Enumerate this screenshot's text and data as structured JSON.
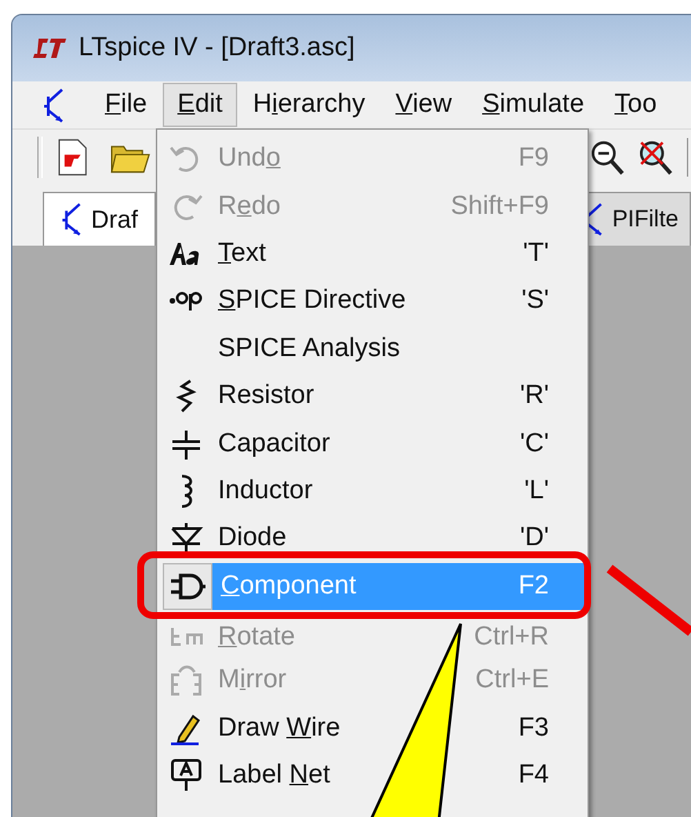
{
  "window": {
    "title": "LTspice IV - [Draft3.asc]"
  },
  "menu_bar": [
    {
      "key": "F",
      "post": "ile",
      "selected": false
    },
    {
      "key": "E",
      "post": "dit",
      "selected": true
    },
    {
      "pre": "H",
      "key": "i",
      "post": "erarchy",
      "selected": false
    },
    {
      "key": "V",
      "post": "iew",
      "selected": false
    },
    {
      "key": "S",
      "post": "imulate",
      "selected": false
    },
    {
      "key": "T",
      "post": "oo",
      "selected": false
    }
  ],
  "tabs": [
    {
      "label": "Draf",
      "selected": true
    },
    {
      "label": "PIFilte",
      "selected": false
    }
  ],
  "edit_menu": [
    {
      "label": {
        "pre": "Und",
        "key": "o"
      },
      "shortcut": "F9",
      "disabled": true,
      "selected": false
    },
    {
      "label": {
        "pre": "R",
        "key": "e",
        "post": "do"
      },
      "shortcut": "Shift+F9",
      "disabled": true,
      "selected": false
    },
    {
      "label": {
        "key": "T",
        "post": "ext"
      },
      "shortcut": "'T'",
      "disabled": false,
      "selected": false
    },
    {
      "label": {
        "key": "S",
        "post": "PICE Directive"
      },
      "shortcut": "'S'",
      "disabled": false,
      "selected": false
    },
    {
      "label": {
        "pre": "SPICE Analysis"
      },
      "disabled": false,
      "selected": false
    },
    {
      "label": {
        "pre": "Resistor"
      },
      "shortcut": "'R'",
      "disabled": false,
      "selected": false
    },
    {
      "label": {
        "pre": "Capacitor"
      },
      "shortcut": "'C'",
      "disabled": false,
      "selected": false
    },
    {
      "label": {
        "pre": "Inductor"
      },
      "shortcut": "'L'",
      "disabled": false,
      "selected": false
    },
    {
      "label": {
        "pre": "Diode"
      },
      "shortcut": "'D'",
      "disabled": false,
      "selected": false
    },
    {
      "label": {
        "key": "C",
        "post": "omponent"
      },
      "shortcut": "F2",
      "disabled": false,
      "selected": true
    },
    {
      "label": {
        "key": "R",
        "post": "otate"
      },
      "shortcut": "Ctrl+R",
      "disabled": true,
      "selected": false
    },
    {
      "label": {
        "pre": "M",
        "key": "i",
        "post": "rror"
      },
      "shortcut": "Ctrl+E",
      "disabled": true,
      "selected": false
    },
    {
      "label": {
        "pre": "Draw ",
        "key": "W",
        "post": "ire"
      },
      "shortcut": "F3",
      "disabled": false,
      "selected": false
    },
    {
      "label": {
        "pre": "Label ",
        "key": "N",
        "post": "et"
      },
      "shortcut": "F4",
      "disabled": false,
      "selected": false
    }
  ]
}
